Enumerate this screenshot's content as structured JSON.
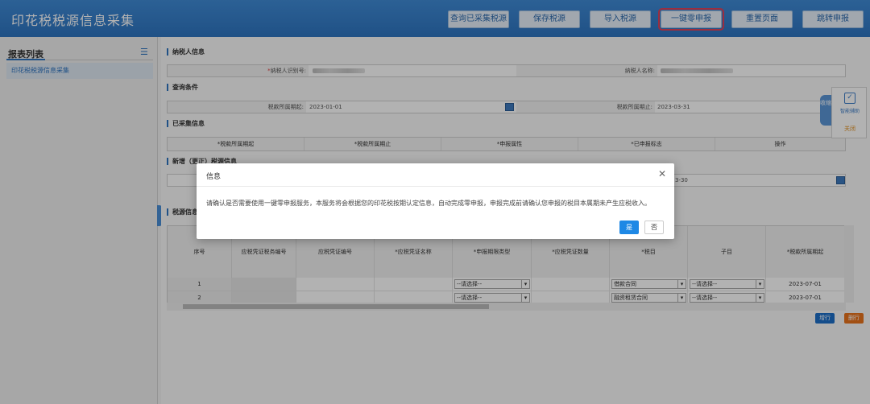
{
  "header": {
    "title": "印花税税源信息采集",
    "buttons": [
      "查询已采集税源",
      "保存税源",
      "导入税源",
      "一键零申报",
      "重置页面",
      "跳转申报"
    ]
  },
  "sidebar": {
    "title": "报表列表",
    "items": [
      "印花税税源信息采集"
    ]
  },
  "sections": {
    "taxpayer": "纳税人信息",
    "query": "查询条件",
    "collected": "已采集信息",
    "new_change": "新增（更正）税源信息",
    "detail": "税源信息"
  },
  "taxpayer": {
    "id_label": "纳税人识别号:",
    "name_label": "纳税人名称:"
  },
  "query": {
    "start_label": "税款所属期起:",
    "start_value": "2023-01-01",
    "end_label": "税款所属期止:",
    "end_value": "2023-03-31"
  },
  "collected_headers": [
    "*税款所属期起",
    "*税款所属期止",
    "*申报属性",
    "*已申报标志",
    "操作"
  ],
  "new_change_partial_value": "3-30",
  "table": {
    "headers": [
      "序号",
      "应税凭证税务编号",
      "应税凭证编号",
      "*应税凭证名称",
      "*申报期限类型",
      "*应税凭证数量",
      "*税目",
      "子目",
      "*税款所属期起"
    ],
    "rows": [
      {
        "no": "1",
        "period_type": "--请选择--",
        "item": "借款合同",
        "sub_item": "--请选择--",
        "start": "2023-07-01"
      },
      {
        "no": "2",
        "period_type": "--请选择--",
        "item": "融资租赁合同",
        "sub_item": "--请选择--",
        "start": "2023-07-01"
      }
    ]
  },
  "table_actions": {
    "add": "增行",
    "delete": "删行"
  },
  "assist": {
    "tab_label": "收缩",
    "label": "智能辅助",
    "close": "关闭"
  },
  "modal": {
    "title": "信息",
    "message": "请确认是否需要使用一键零申报服务，本服务将会根据您的印花税按期认定信息，自动完成零申报，申报完成前请确认您申报的税目本属期未产生应税收入。",
    "yes": "是",
    "no": "否"
  },
  "colors": {
    "header": "#2e74c0",
    "highlight_border": "#e0425b",
    "primary": "#1e88e5",
    "delete_btn": "#e8731e"
  }
}
